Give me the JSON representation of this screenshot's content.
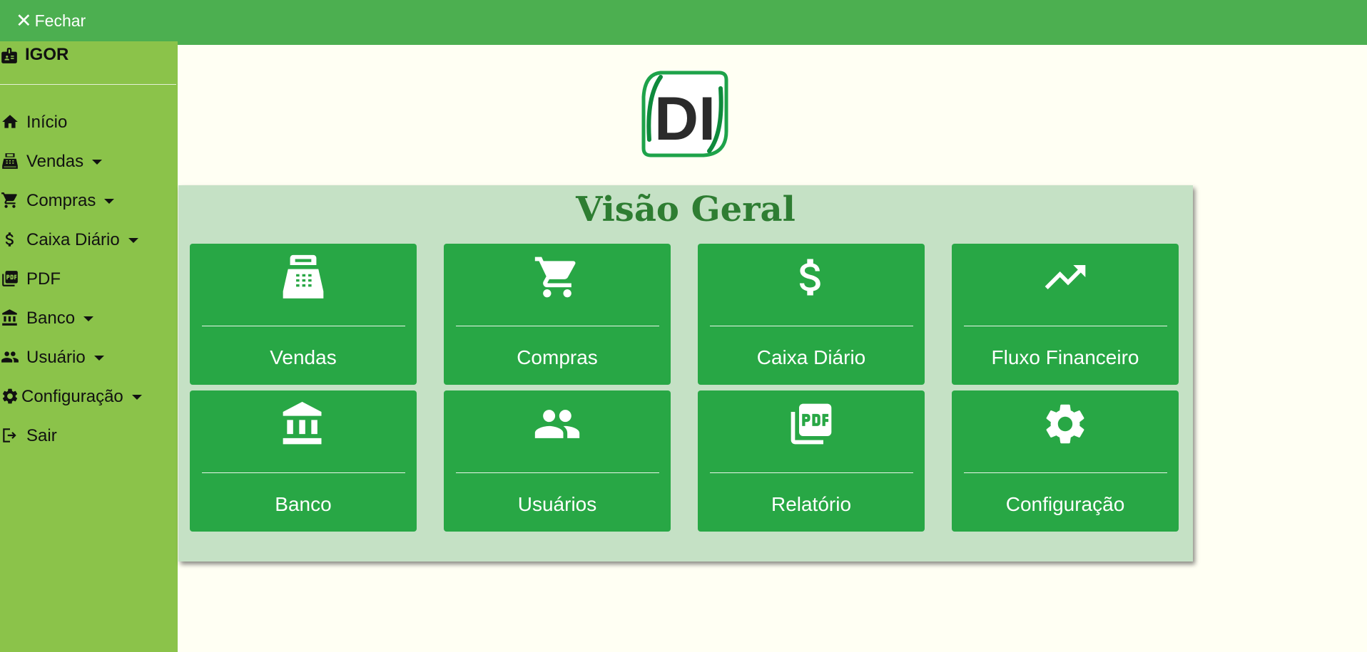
{
  "sidebar": {
    "close_label": "Fechar",
    "user_name": "IGOR",
    "items": [
      {
        "label": "Início",
        "icon": "home-icon",
        "dropdown": false
      },
      {
        "label": "Vendas",
        "icon": "cash-register-icon",
        "dropdown": true
      },
      {
        "label": "Compras",
        "icon": "cart-icon",
        "dropdown": true
      },
      {
        "label": "Caixa Diário",
        "icon": "dollar-icon",
        "dropdown": true
      },
      {
        "label": "PDF",
        "icon": "pdf-icon",
        "dropdown": false
      },
      {
        "label": "Banco",
        "icon": "bank-icon",
        "dropdown": true
      },
      {
        "label": "Usuário",
        "icon": "users-icon",
        "dropdown": true
      },
      {
        "label": "Configuração",
        "icon": "gear-icon",
        "dropdown": true
      },
      {
        "label": "Sair",
        "icon": "logout-icon",
        "dropdown": false
      }
    ]
  },
  "logo": {
    "text": "DI"
  },
  "panel": {
    "title": "Visão Geral",
    "cards": [
      {
        "label": "Vendas",
        "icon": "cash-register-icon"
      },
      {
        "label": "Compras",
        "icon": "cart-icon"
      },
      {
        "label": "Caixa Diário",
        "icon": "dollar-icon"
      },
      {
        "label": "Fluxo Financeiro",
        "icon": "trending-up-icon"
      },
      {
        "label": "Banco",
        "icon": "bank-icon"
      },
      {
        "label": "Usuários",
        "icon": "users-icon"
      },
      {
        "label": "Relatório",
        "icon": "pdf-icon"
      },
      {
        "label": "Configuração",
        "icon": "gear-icon"
      }
    ]
  },
  "colors": {
    "sidebar": "#8bc34a",
    "topbar": "#4caf50",
    "card": "#28a745",
    "panel": "#c5e1c5",
    "title": "#2e7d32",
    "background": "#fffff3"
  }
}
